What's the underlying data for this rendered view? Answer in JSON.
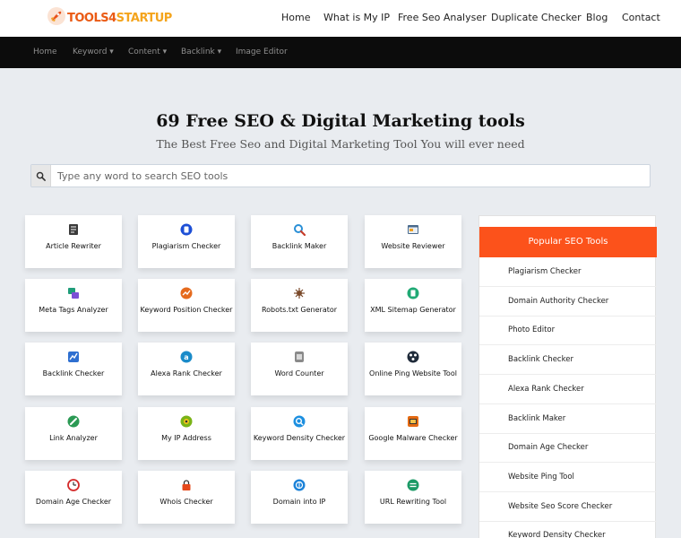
{
  "brand": {
    "name_part1": "TOOLS4",
    "name_part2": "STARTUP",
    "logo_icon": "rocket-icon"
  },
  "top_nav": [
    "Home",
    "What is My IP",
    "Free Seo Analyser",
    "Duplicate Checker",
    "Blog",
    "Contact"
  ],
  "sub_nav": [
    "Home",
    "Keyword ▾",
    "Content ▾",
    "Backlink ▾",
    "Image Editor"
  ],
  "hero": {
    "title": "69 Free SEO & Digital Marketing tools",
    "subtitle": "The Best Free Seo and Digital Marketing Tool You will ever need"
  },
  "search": {
    "placeholder": "Type any word to search SEO tools",
    "value": "",
    "icon": "search-icon"
  },
  "tools": [
    {
      "label": "Article Rewriter",
      "icon": "article-rewriter-icon",
      "color": "#3b3b3b"
    },
    {
      "label": "Plagiarism Checker",
      "icon": "plagiarism-icon",
      "color": "#1d4fd6"
    },
    {
      "label": "Backlink Maker",
      "icon": "magnifier-icon",
      "color": "#2a8fd6"
    },
    {
      "label": "Website Reviewer",
      "icon": "browser-icon",
      "color": "#4a6a8c"
    },
    {
      "label": "Meta Tags Analyzer",
      "icon": "meta-tags-icon",
      "color": "#1f9d7a"
    },
    {
      "label": "Keyword Position Checker",
      "icon": "keyword-position-icon",
      "color": "#e56a1d"
    },
    {
      "label": "Robots.txt Generator",
      "icon": "robot-icon",
      "color": "#7a4a2a"
    },
    {
      "label": "XML Sitemap Generator",
      "icon": "sitemap-icon",
      "color": "#1fa974"
    },
    {
      "label": "Backlink Checker",
      "icon": "backlink-checker-icon",
      "color": "#2e6fd0"
    },
    {
      "label": "Alexa Rank Checker",
      "icon": "alexa-icon",
      "color": "#1a8bc9"
    },
    {
      "label": "Word Counter",
      "icon": "word-counter-icon",
      "color": "#8a8a8a"
    },
    {
      "label": "Online Ping Website Tool",
      "icon": "ping-icon",
      "color": "#1f2b3a"
    },
    {
      "label": "Link Analyzer",
      "icon": "link-icon",
      "color": "#2b9a54"
    },
    {
      "label": "My IP Address",
      "icon": "ip-address-icon",
      "color": "#7ab317"
    },
    {
      "label": "Keyword Density Checker",
      "icon": "keyword-density-icon",
      "color": "#1c8fe0"
    },
    {
      "label": "Google Malware Checker",
      "icon": "malware-icon",
      "color": "#e46a12"
    },
    {
      "label": "Domain Age Checker",
      "icon": "clock-icon",
      "color": "#d42a2a"
    },
    {
      "label": "Whois Checker",
      "icon": "lock-icon",
      "color": "#e5481b"
    },
    {
      "label": "Domain into IP",
      "icon": "globe-icon",
      "color": "#1b82d8"
    },
    {
      "label": "URL Rewriting Tool",
      "icon": "url-rewrite-icon",
      "color": "#1b9a66"
    }
  ],
  "sidebar": {
    "title": "Popular SEO Tools",
    "items": [
      "Plagiarism Checker",
      "Domain Authority Checker",
      "Photo Editor",
      "Backlink Checker",
      "Alexa Rank Checker",
      "Backlink Maker",
      "Domain Age Checker",
      "Website Ping Tool",
      "Website Seo Score Checker",
      "Keyword Density Checker"
    ]
  }
}
